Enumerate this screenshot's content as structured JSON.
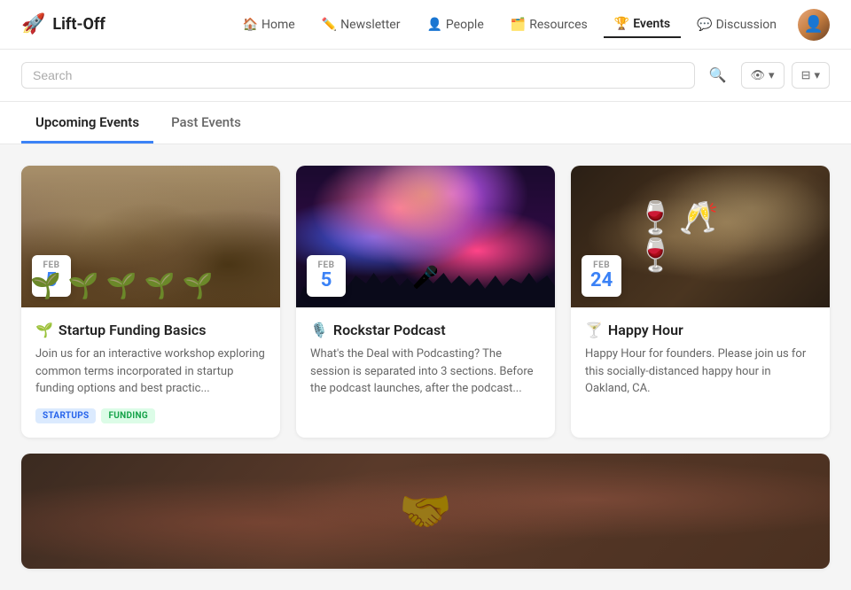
{
  "logo": {
    "icon": "🚀",
    "name": "Lift-Off"
  },
  "nav": {
    "items": [
      {
        "label": "Home",
        "icon": "🏠",
        "active": false
      },
      {
        "label": "Newsletter",
        "icon": "✏️",
        "active": false
      },
      {
        "label": "People",
        "icon": "👤",
        "active": false
      },
      {
        "label": "Resources",
        "icon": "🗂️",
        "active": false
      },
      {
        "label": "Events",
        "icon": "🏆",
        "active": true
      },
      {
        "label": "Discussion",
        "icon": "💬",
        "active": false
      }
    ]
  },
  "search": {
    "placeholder": "Search"
  },
  "tabs": [
    {
      "label": "Upcoming Events",
      "active": true
    },
    {
      "label": "Past Events",
      "active": false
    }
  ],
  "events": [
    {
      "date_month": "FEB",
      "date_day": "5",
      "emoji": "🌱",
      "title": "Startup Funding Basics",
      "description": "Join us for an interactive workshop exploring common terms incorporated in startup funding options and best practic...",
      "tags": [
        "STARTUPS",
        "FUNDING"
      ]
    },
    {
      "date_month": "FEB",
      "date_day": "5",
      "emoji": "🎙️",
      "title": "Rockstar Podcast",
      "description": "What's the Deal with Podcasting? The session is separated into 3 sections. Before the podcast launches, after the podcast...",
      "tags": []
    },
    {
      "date_month": "FEB",
      "date_day": "24",
      "emoji": "🍸",
      "title": "Happy Hour",
      "description": "Happy Hour for founders. Please join us for this socially-distanced happy hour in Oakland, CA.",
      "tags": []
    }
  ],
  "bottom_event": {
    "image_alt": "Handshake"
  },
  "icons": {
    "search": "🔍",
    "view": "👁",
    "filter": "⊟",
    "chevron_down": "▾"
  }
}
